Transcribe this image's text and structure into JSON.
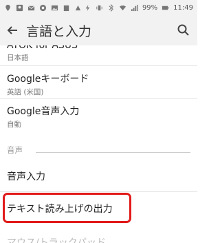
{
  "status_bar": {
    "battery_percent": "99%",
    "time": "11:49"
  },
  "app_bar": {
    "title": "言語と入力"
  },
  "items": [
    {
      "title": "ATOK for ASUS",
      "subtitle": "日本語"
    },
    {
      "title": "Googleキーボード",
      "subtitle": "英語 (米国)"
    },
    {
      "title": "Google音声入力",
      "subtitle": "自動"
    }
  ],
  "section": {
    "label": "音声"
  },
  "voice_items": [
    {
      "title": "音声入力"
    },
    {
      "title": "テキスト読み上げの出力"
    }
  ],
  "next_item": {
    "title": "マウス/トラックパッド"
  },
  "colors": {
    "highlight": "#e11a1a",
    "app_bar_bg": "#f2f2f2"
  },
  "icons": [
    "back-arrow-icon",
    "search-icon",
    "notification-icons",
    "wifi-icon",
    "signal-icon",
    "battery-icon"
  ]
}
